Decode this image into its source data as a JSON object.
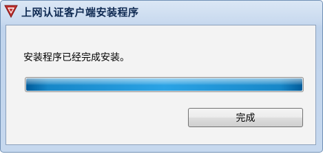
{
  "window": {
    "title": "上网认证客户端安装程序",
    "icon": "red-triangle-logo-icon"
  },
  "content": {
    "message": "安装程序已经完成安装。",
    "progress_percent": 100
  },
  "buttons": {
    "finish_label": "完成"
  },
  "colors": {
    "title_text": "#0f2a52",
    "progress_fill": "#2aa3e5",
    "logo": "#c0312f"
  }
}
